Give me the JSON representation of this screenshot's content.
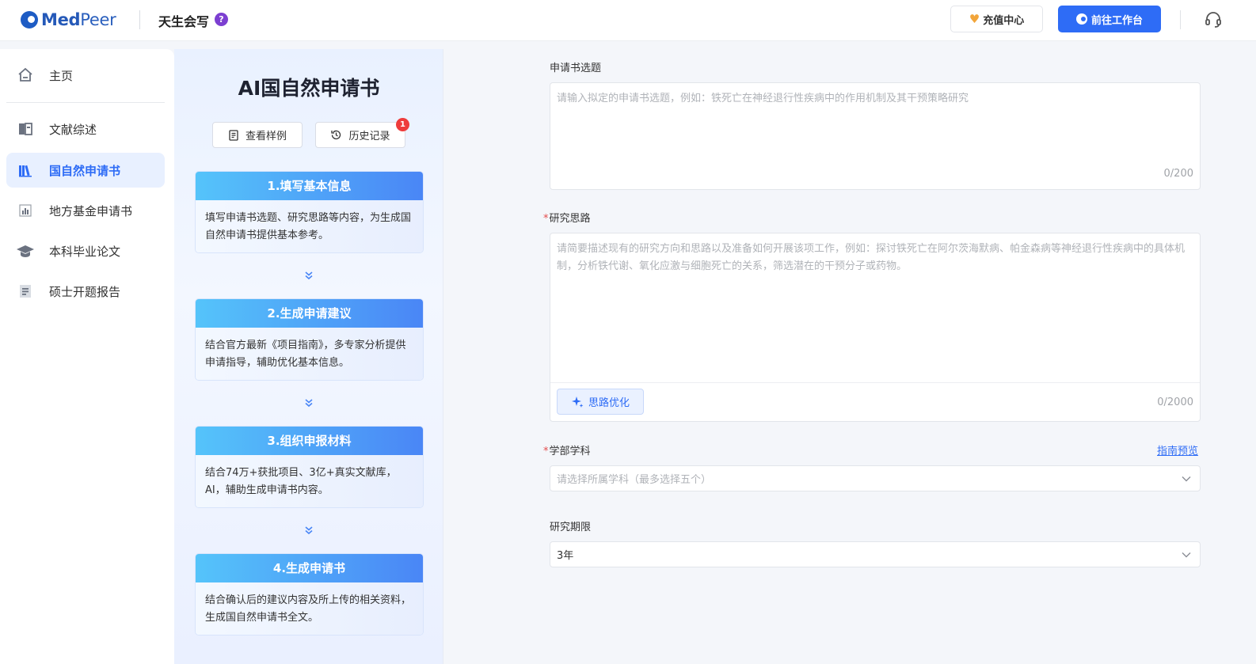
{
  "header": {
    "logo_med": "Med",
    "logo_peer": "Peer",
    "app_name": "天生会写",
    "help": "?",
    "recharge_label": "充值中心",
    "workbench_label": "前往工作台"
  },
  "sidebar": {
    "items": [
      {
        "label": "主页",
        "icon": "home-icon"
      },
      {
        "label": "文献综述",
        "icon": "book-icon"
      },
      {
        "label": "国自然申请书",
        "icon": "books-icon",
        "active": true
      },
      {
        "label": "地方基金申请书",
        "icon": "bar-chart-icon"
      },
      {
        "label": "本科毕业论文",
        "icon": "graduation-cap-icon"
      },
      {
        "label": "硕士开题报告",
        "icon": "document-icon"
      }
    ]
  },
  "middle": {
    "title": "AI国自然申请书",
    "example_btn": "查看样例",
    "history_btn": "历史记录",
    "history_badge": "1",
    "steps": [
      {
        "title": "1.填写基本信息",
        "desc": "填写申请书选题、研究思路等内容，为生成国自然申请书提供基本参考。"
      },
      {
        "title": "2.生成申请建议",
        "desc": "结合官方最新《项目指南》，多专家分析提供申请指导，辅助优化基本信息。"
      },
      {
        "title": "3.组织申报材料",
        "desc": "结合74万+获批项目、3亿+真实文献库，AI，辅助生成申请书内容。"
      },
      {
        "title": "4.生成申请书",
        "desc": "结合确认后的建议内容及所上传的相关资料，生成国自然申请书全文。"
      }
    ]
  },
  "form": {
    "topic_label": "申请书选题",
    "topic_placeholder": "请输入拟定的申请书选题，例如：铁死亡在神经退行性疾病中的作用机制及其干预策略研究",
    "topic_counter": "0/200",
    "idea_required": "*",
    "idea_label": "研究思路",
    "idea_placeholder": "请简要描述现有的研究方向和思路以及准备如何开展该项工作，例如：探讨铁死亡在阿尔茨海默病、帕金森病等神经退行性疾病中的具体机制，分析铁代谢、氧化应激与细胞死亡的关系，筛选潜在的干预分子或药物。",
    "idea_counter": "0/2000",
    "optimize_label": "思路优化",
    "subject_required": "*",
    "subject_label": "学部学科",
    "guide_link": "指南预览",
    "subject_placeholder": "请选择所属学科（最多选择五个）",
    "period_label": "研究期限",
    "period_value": "3年"
  },
  "colors": {
    "accent": "#2e6cf6",
    "required": "#e34d4d",
    "badge": "#ee3b3b",
    "step_gradient_start": "#55c4fa",
    "step_gradient_end": "#4a86f6"
  }
}
